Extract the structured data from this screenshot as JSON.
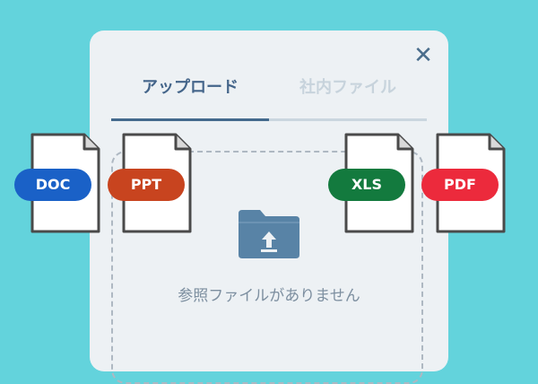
{
  "dialog": {
    "tabs": [
      {
        "label": "アップロード",
        "active": true
      },
      {
        "label": "社内ファイル",
        "active": false
      }
    ],
    "close_icon": "close-icon",
    "empty_message": "参照ファイルがありません",
    "upload_icon": "folder-upload-icon"
  },
  "file_types": [
    {
      "label": "DOC",
      "color": "#1a61c7"
    },
    {
      "label": "PPT",
      "color": "#c8441f"
    },
    {
      "label": "XLS",
      "color": "#137a3e"
    },
    {
      "label": "PDF",
      "color": "#ec2a3c"
    }
  ],
  "colors": {
    "background": "#63d3dc",
    "panel": "#edf1f4",
    "accent": "#446a8d"
  }
}
